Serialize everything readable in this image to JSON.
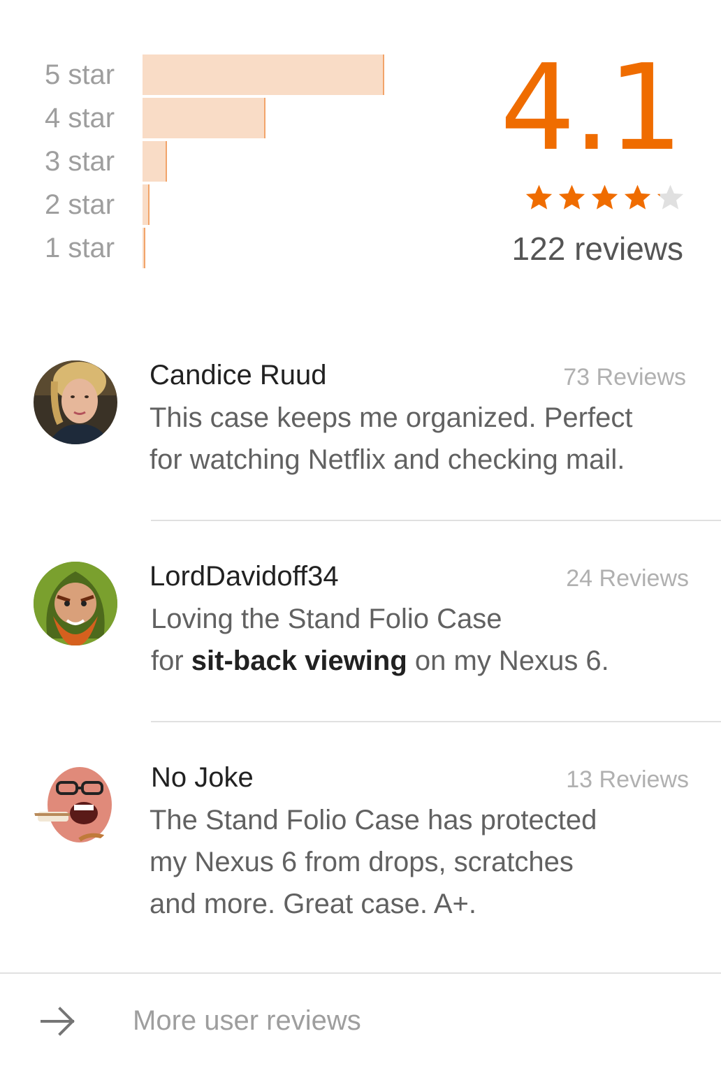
{
  "rating_summary": {
    "average": "4.1",
    "reviews_label": "122 reviews",
    "star_rating_value": 4.1,
    "accent_color": "#ef6c00",
    "histogram": [
      {
        "label": "5 star",
        "share": 1.0
      },
      {
        "label": "4 star",
        "share": 0.51
      },
      {
        "label": "3 star",
        "share": 0.1
      },
      {
        "label": "2 star",
        "share": 0.03
      },
      {
        "label": "1 star",
        "share": 0.01
      }
    ]
  },
  "reviews": [
    {
      "name": "Candice Ruud",
      "count": "73 Reviews",
      "text": "This case keeps me organized. Perfect for watching Netflix and checking mail."
    },
    {
      "name": "LordDavidoff34",
      "count": "24 Reviews",
      "text_prefix": "Loving the Stand Folio Case",
      "text_line2_start": "for ",
      "text_bold": "sit-back viewing",
      "text_suffix": " on my Nexus 6."
    },
    {
      "name": "No Joke",
      "count": "13 Reviews",
      "text": "The Stand Folio Case has protected my Nexus 6 from drops, scratches and more. Great case. A+."
    }
  ],
  "footer": {
    "more_label": "More user reviews",
    "icon": "arrow-right-icon"
  }
}
